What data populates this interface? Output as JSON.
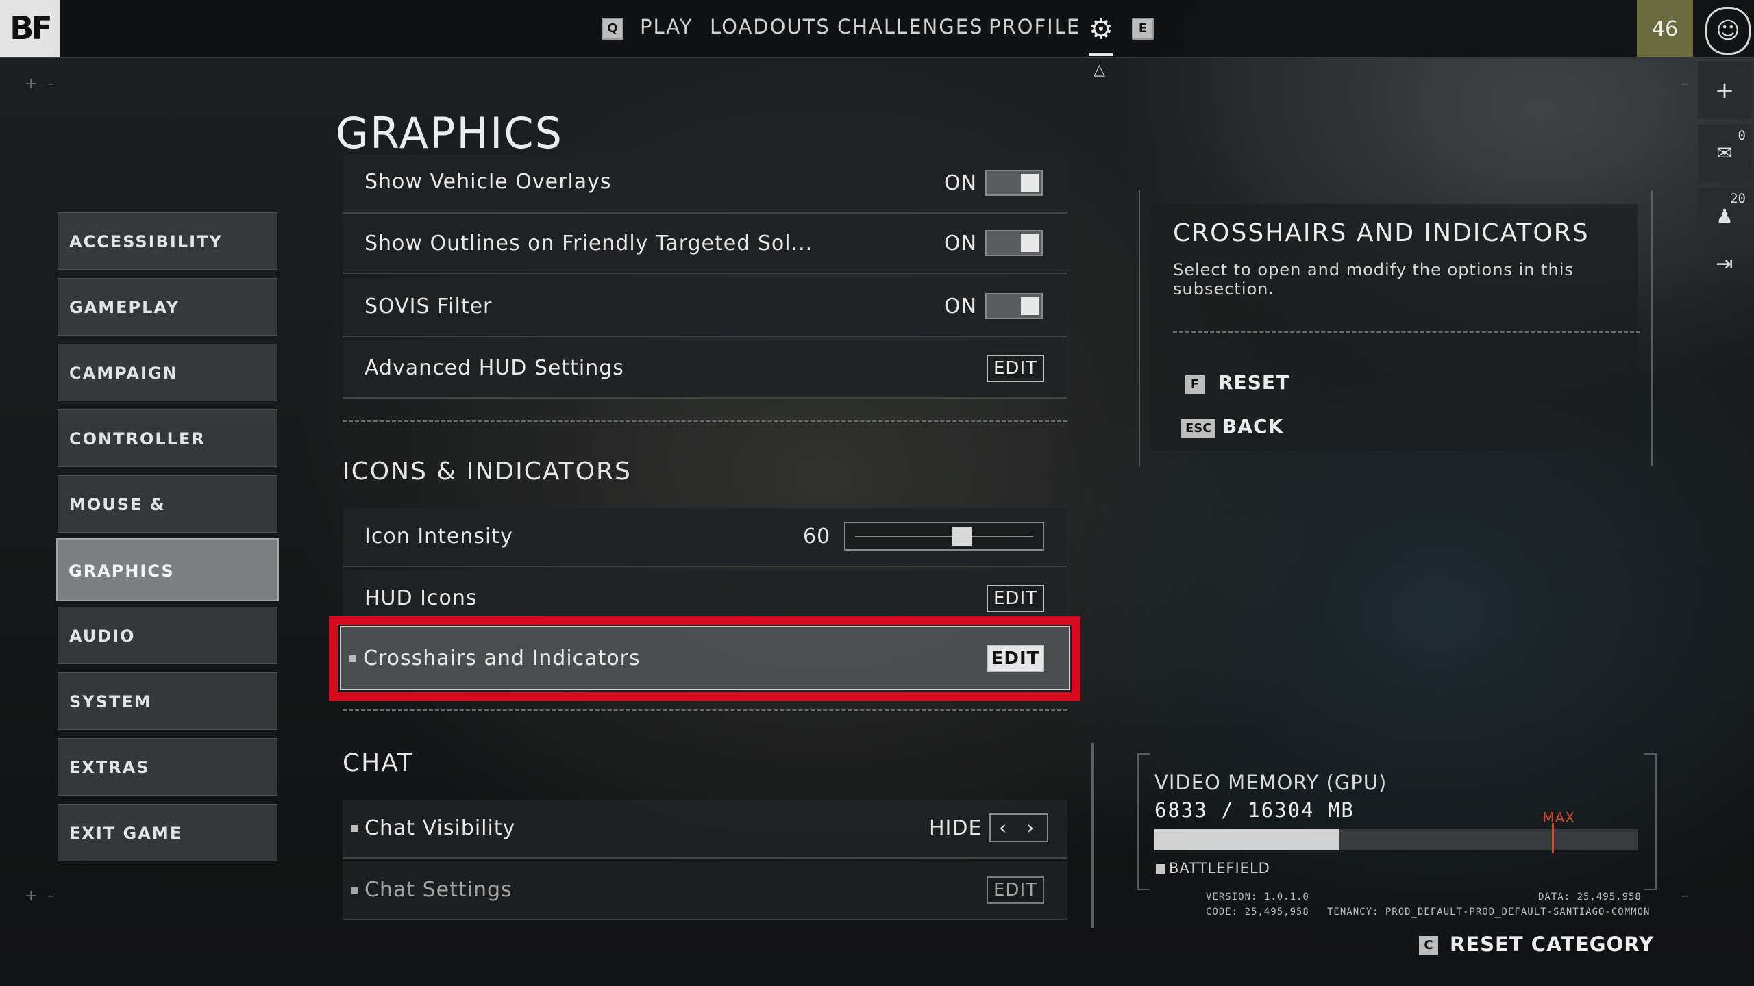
{
  "nav": {
    "logo": "BF",
    "key_left": "Q",
    "key_right": "E",
    "items": [
      "PLAY",
      "LOADOUTS",
      "CHALLENGES",
      "PROFILE"
    ],
    "settings_icon": "gear-icon",
    "player_level": "46",
    "avatar_icon": "soldier-avatar-icon"
  },
  "rail": {
    "add_icon": "plus-icon",
    "mail_count": "0",
    "mail_icon": "mail-icon",
    "squad_count": "20",
    "squad_icon": "squad-icon",
    "exit_icon": "logout-icon"
  },
  "menu": {
    "items": [
      "ACCESSIBILITY",
      "GAMEPLAY",
      "CAMPAIGN",
      "CONTROLLER",
      "MOUSE & KEYBOARD",
      "GRAPHICS",
      "AUDIO",
      "SYSTEM",
      "EXTRAS",
      "EXIT GAME"
    ],
    "active": "GRAPHICS"
  },
  "page": {
    "title": "GRAPHICS"
  },
  "settings": {
    "rows_top": [
      {
        "label": "Show Vehicle Overlays",
        "value": "ON",
        "control": "toggle"
      },
      {
        "label": "Show Outlines on Friendly Targeted Sol...",
        "value": "ON",
        "control": "toggle"
      },
      {
        "label": "SOVIS Filter",
        "value": "ON",
        "control": "toggle"
      },
      {
        "label": "Advanced HUD Settings",
        "control": "edit",
        "button": "EDIT"
      }
    ],
    "icons_section": "ICONS & INDICATORS",
    "icon_intensity": {
      "label": "Icon Intensity",
      "value": "60",
      "fraction": 0.6
    },
    "hud_icons": {
      "label": "HUD Icons",
      "button": "EDIT"
    },
    "crosshairs": {
      "label": "Crosshairs and Indicators",
      "button": "EDIT"
    },
    "chat_section": "CHAT",
    "chat_visibility": {
      "label": "Chat Visibility",
      "value": "HIDE"
    },
    "chat_settings": {
      "label": "Chat Settings",
      "button": "EDIT"
    }
  },
  "info": {
    "title": "CROSSHAIRS AND INDICATORS",
    "description": "Select to open and modify the options in this subsection.",
    "reset_key": "F",
    "reset_label": "RESET",
    "back_key": "ESC",
    "back_label": "BACK"
  },
  "vram": {
    "title": "VIDEO MEMORY (GPU)",
    "value": "6833 / 16304 MB",
    "used_fraction": 0.381,
    "max_fraction": 0.822,
    "max_label": "MAX",
    "legend": "BATTLEFIELD"
  },
  "meta": {
    "version": "VERSION: 1.0.1.0",
    "code": "CODE: 25,495,958",
    "data": "DATA: 25,495,958",
    "tenancy": "TENANCY: PROD_DEFAULT-PROD_DEFAULT-SANTIAGO-COMMON"
  },
  "footer": {
    "reset_category_key": "C",
    "reset_category": "RESET CATEGORY"
  },
  "colors": {
    "highlight": "#d6081b",
    "vram_max": "#d04a2a",
    "accent_level": "#6b6a3c"
  }
}
